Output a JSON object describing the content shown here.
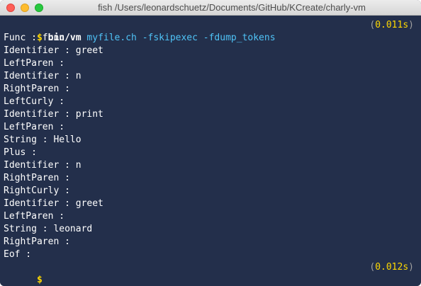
{
  "window": {
    "title": "fish  /Users/leonardschuetz/Documents/GitHub/KCreate/charly-vm"
  },
  "terminal": {
    "command": {
      "prompt": "$",
      "binary": "bin/vm",
      "args": "myfile.ch -fskipexec -fdump_tokens",
      "duration": "0.011s"
    },
    "tokens": [
      "Func : func",
      "Identifier : greet",
      "LeftParen :",
      "Identifier : n",
      "RightParen :",
      "LeftCurly :",
      "Identifier : print",
      "LeftParen :",
      "String : Hello",
      "Plus :",
      "Identifier : n",
      "RightParen :",
      "RightCurly :",
      "Identifier : greet",
      "LeftParen :",
      "String : leonard",
      "RightParen :",
      "Eof :"
    ],
    "final_prompt": {
      "prompt": "$",
      "duration": "0.012s"
    }
  },
  "colors": {
    "background": "#232f4b",
    "prompt": "#ffd900",
    "args": "#4fc3f7",
    "text": "#ffffff"
  }
}
